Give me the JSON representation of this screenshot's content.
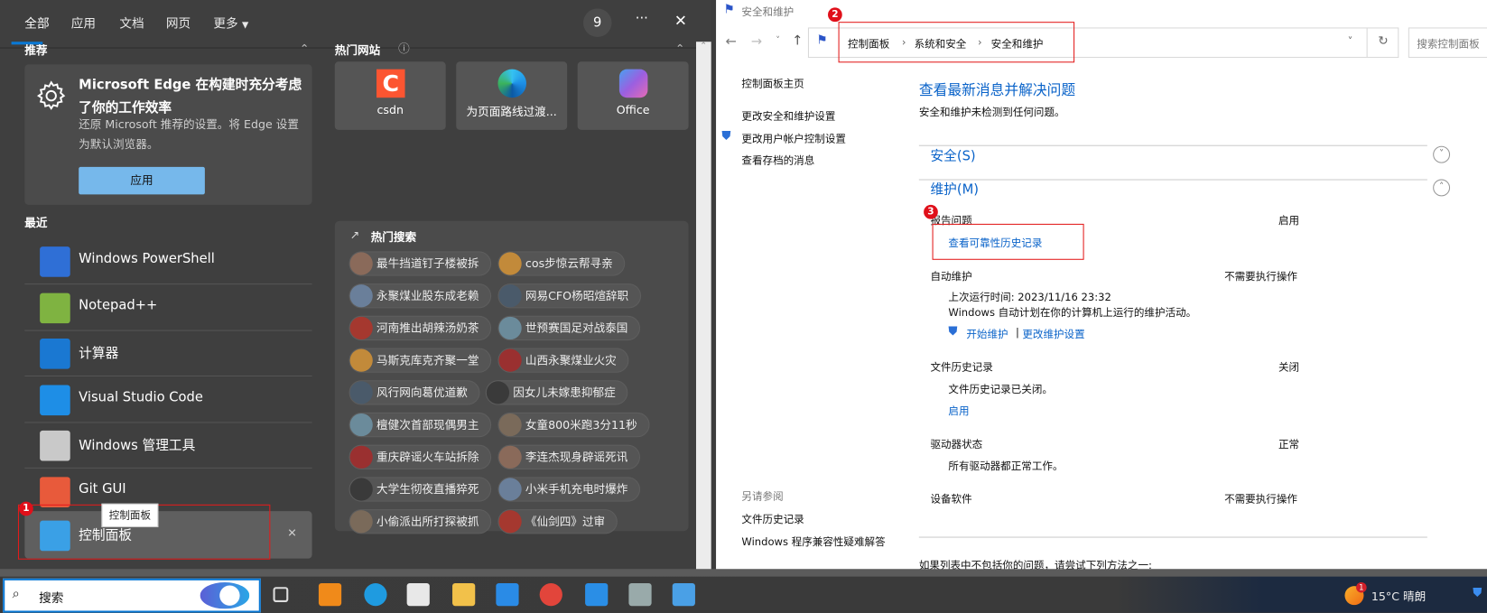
{
  "search_panel": {
    "tabs": [
      "全部",
      "应用",
      "文档",
      "网页",
      "更多"
    ],
    "reward_count": "9",
    "more_label": "···",
    "close_label": "✕",
    "recommend": {
      "section_label": "推荐",
      "title": "Microsoft Edge 在构建时充分考虑了你的工作效率",
      "description": "还原 Microsoft 推荐的设置。将 Edge 设置为默认浏览器。",
      "button": "应用"
    },
    "top_sites": {
      "section_label": "热门网站",
      "items": [
        {
          "label": "csdn",
          "icon": "csdn-icon"
        },
        {
          "label": "为页面路线过渡...",
          "icon": "edge-icon"
        },
        {
          "label": "Office",
          "icon": "office-icon"
        }
      ]
    },
    "recent": {
      "section_label": "最近",
      "items": [
        {
          "label": "Windows PowerShell",
          "icon": "powershell-icon"
        },
        {
          "label": "Notepad++",
          "icon": "notepadpp-icon"
        },
        {
          "label": "计算器",
          "icon": "calculator-icon"
        },
        {
          "label": "Visual Studio Code",
          "icon": "vscode-icon"
        },
        {
          "label": "Windows 管理工具",
          "icon": "admin-tools-icon"
        },
        {
          "label": "Git GUI",
          "icon": "git-gui-icon"
        },
        {
          "label": "控制面板",
          "icon": "control-panel-icon",
          "selected": true
        }
      ],
      "tooltip": "控制面板"
    },
    "hot_search": {
      "section_label": "热门搜索",
      "rows": [
        [
          "最牛挡道钉子楼被拆",
          "cos步惊云帮寻亲"
        ],
        [
          "永聚煤业股东成老赖",
          "网易CFO杨昭煊辞职"
        ],
        [
          "河南推出胡辣汤奶茶",
          "世预赛国足对战泰国"
        ],
        [
          "马斯克库克齐聚一堂",
          "山西永聚煤业火灾"
        ],
        [
          "风行网向葛优道歉",
          "因女儿未嫁患抑郁症"
        ],
        [
          "檀健次首部现偶男主",
          "女童800米跑3分11秒"
        ],
        [
          "重庆辟谣火车站拆除",
          "李连杰现身辟谣死讯"
        ],
        [
          "大学生彻夜直播猝死",
          "小米手机充电时爆炸"
        ],
        [
          "小偷派出所打探被抓",
          "《仙剑四》过审"
        ]
      ]
    }
  },
  "annotations": [
    "1",
    "2",
    "3"
  ],
  "window": {
    "title": "安全和维护",
    "breadcrumb": [
      "控制面板",
      "系统和安全",
      "安全和维护"
    ],
    "search_placeholder": "搜索控制面板",
    "sidebar": {
      "home": "控制面板主页",
      "links": [
        "更改安全和维护设置",
        "更改用户帐户控制设置",
        "查看存档的消息"
      ],
      "see_also_label": "另请参阅",
      "see_also": [
        "文件历史记录",
        "Windows 程序兼容性疑难解答"
      ]
    },
    "heading": "查看最新消息并解决问题",
    "subheading": "安全和维护未检测到任何问题。",
    "security_label": "安全(S)",
    "maintenance_label": "维护(M)",
    "maintenance": {
      "report": {
        "label": "报告问题",
        "status": "启用",
        "link": "查看可靠性历史记录"
      },
      "auto": {
        "label": "自动维护",
        "status": "不需要执行操作",
        "last_run": "上次运行时间: 2023/11/16 23:32",
        "desc": "Windows 自动计划在你的计算机上运行的维护活动。",
        "start": "开始维护",
        "sep": "|",
        "change": "更改维护设置"
      },
      "file_history": {
        "label": "文件历史记录",
        "status": "关闭",
        "desc": "文件历史记录已关闭。",
        "link": "启用"
      },
      "drive": {
        "label": "驱动器状态",
        "status": "正常",
        "desc": "所有驱动器都正常工作。"
      },
      "device": {
        "label": "设备软件",
        "status": "不需要执行操作"
      }
    },
    "footer": "如果列表中不包括你的问题，请尝试下列方法之一:"
  },
  "taskbar": {
    "search_label": "搜索",
    "apps": [
      "task-view-icon",
      "everything-search-icon",
      "edge-icon",
      "store-icon",
      "file-explorer-icon",
      "mail-icon",
      "chrome-icon",
      "vscode-icon",
      "printer-icon",
      "control-panel-icon"
    ],
    "weather": "15°C 晴朗",
    "notification_count": "1"
  },
  "colors": {
    "accent": "#0a78d4",
    "link": "#0a63c9",
    "annotation": "#e31b1b"
  }
}
